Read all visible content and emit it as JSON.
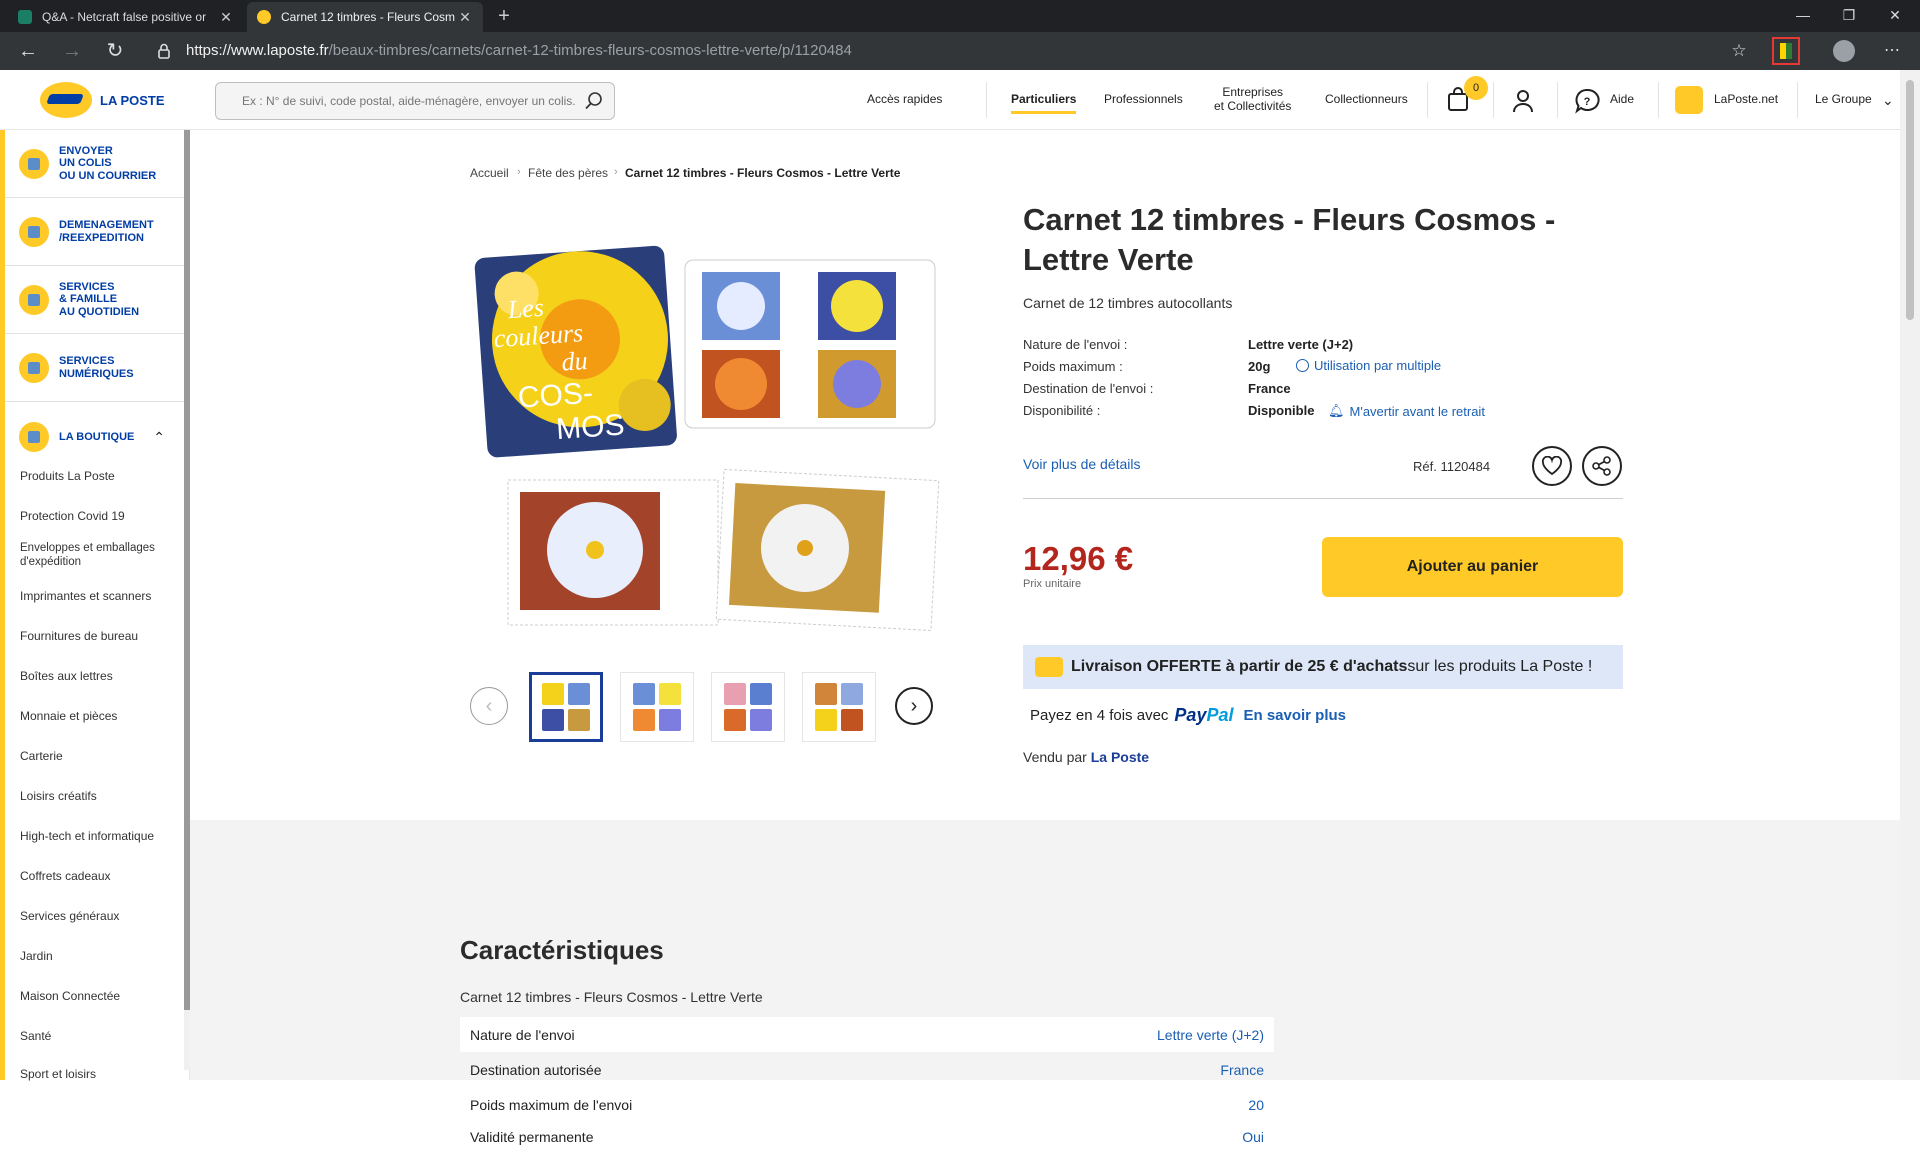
{
  "browser": {
    "tabs": [
      {
        "title": "Q&A - Netcraft false positive or",
        "favicon_color": "#1a7f64"
      },
      {
        "title": "Carnet 12 timbres - Fleurs Cosm",
        "favicon_color": "#ffc928"
      }
    ],
    "url_host": "https://www.laposte.fr",
    "url_path": "/beaux-timbres/carnets/carnet-12-timbres-fleurs-cosmos-lettre-verte/p/1120484"
  },
  "header": {
    "logo_text": "LA POSTE",
    "search_placeholder": "Ex : N° de suivi, code postal, aide-ménagère, envoyer un colis...",
    "acces_rapides": "Accès rapides",
    "nav": {
      "particuliers": "Particuliers",
      "professionnels": "Professionnels",
      "entreprises_1": "Entreprises",
      "entreprises_2": "et Collectivités",
      "collectionneurs": "Collectionneurs"
    },
    "cart_count": "0",
    "aide": "Aide",
    "laposte_net": "LaPoste.net",
    "le_groupe": "Le Groupe"
  },
  "sidebar": {
    "sections": [
      {
        "l1": "ENVOYER",
        "l2": "UN COLIS",
        "l3": "OU UN COURRIER"
      },
      {
        "l1": "DEMENAGEMENT",
        "l2": "/REEXPEDITION"
      },
      {
        "l1": "SERVICES",
        "l2": "& FAMILLE",
        "l3": "AU QUOTIDIEN"
      },
      {
        "l1": "SERVICES",
        "l2": "NUMÉRIQUES"
      },
      {
        "l1": "LA BOUTIQUE"
      }
    ],
    "items": [
      "Produits La Poste",
      "Protection Covid 19",
      "Enveloppes et emballages d'expédition",
      "Imprimantes et scanners",
      "Fournitures de bureau",
      "Boîtes aux lettres",
      "Monnaie et pièces",
      "Carterie",
      "Loisirs créatifs",
      "High-tech et informatique",
      "Coffrets cadeaux",
      "Services généraux",
      "Jardin",
      "Maison Connectée",
      "Santé",
      "Sport et loisirs"
    ]
  },
  "breadcrumb": [
    "Accueil",
    "Fête des pères",
    "Carnet 12 timbres - Fleurs Cosmos - Lettre Verte"
  ],
  "product": {
    "title_1": "Carnet 12 timbres - Fleurs Cosmos -",
    "title_2": "Lettre Verte",
    "subtitle": "Carnet de 12 timbres autocollants",
    "specs": [
      {
        "label": "Nature de l'envoi :",
        "value": "Lettre verte (J+2)"
      },
      {
        "label": "Poids maximum :",
        "value": "20g"
      },
      {
        "label": "Destination de l'envoi :",
        "value": "France"
      },
      {
        "label": "Disponibilité :",
        "value": "Disponible"
      }
    ],
    "multiple_link": "Utilisation par multiple",
    "alert_link": "M'avertir avant le retrait",
    "more_details": "Voir plus de détails",
    "ref": "Réf. 1120484",
    "price": "12,96 €",
    "price_sub": "Prix unitaire",
    "add_to_cart": "Ajouter au panier",
    "promo_bold": "Livraison OFFERTE à partir de 25 € d'achats",
    "promo_rest": " sur les produits La Poste !",
    "paypal_prefix": "Payez en 4 fois avec",
    "paypal_a": "Pay",
    "paypal_b": "Pal",
    "paypal_more": "En savoir plus",
    "sold_prefix": "Vendu par ",
    "sold_by": "La Poste",
    "stamp_text": [
      "Les",
      "couleurs",
      "du",
      "COS-",
      "MOS"
    ]
  },
  "carac": {
    "heading": "Caractéristiques",
    "subtitle": "Carnet 12 timbres - Fleurs Cosmos - Lettre Verte",
    "rows": [
      {
        "label": "Nature de l'envoi",
        "value": "Lettre verte (J+2)"
      },
      {
        "label": "Destination autorisée",
        "value": "France"
      },
      {
        "label": "Poids maximum de l'envoi",
        "value": "20"
      },
      {
        "label": "Validité permanente",
        "value": "Oui"
      }
    ]
  },
  "colors": {
    "brand_yellow": "#ffc928",
    "brand_blue": "#003da5",
    "price_red": "#b3261e",
    "link_blue": "#1a5fb4"
  }
}
